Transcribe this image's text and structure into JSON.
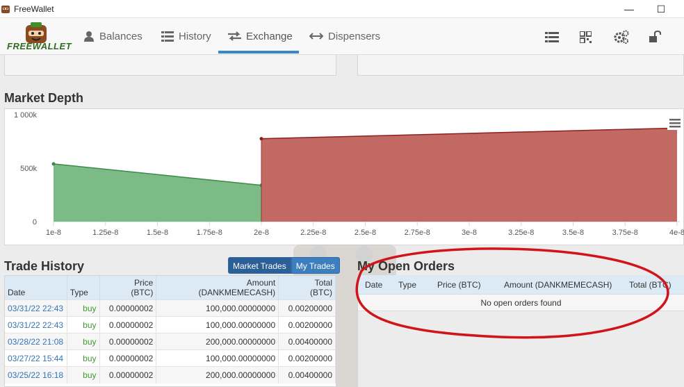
{
  "window": {
    "title": "FreeWallet",
    "minimize_glyph": "—",
    "maximize_glyph": "☐"
  },
  "brand": {
    "name": "FREEWALLET"
  },
  "nav": {
    "items": [
      {
        "label": "Balances",
        "icon": "user-icon"
      },
      {
        "label": "History",
        "icon": "list-icon"
      },
      {
        "label": "Exchange",
        "icon": "exchange-icon",
        "active": true
      },
      {
        "label": "Dispensers",
        "icon": "arrows-horizontal-icon"
      }
    ],
    "tools": [
      "menu-list-icon",
      "qr-code-icon",
      "gears-icon",
      "unlock-icon"
    ]
  },
  "market_depth": {
    "title": "Market Depth"
  },
  "chart_data": {
    "type": "area",
    "title": "",
    "xlabel": "",
    "ylabel": "",
    "x_ticks": [
      "1e-8",
      "1.25e-8",
      "1.5e-8",
      "1.75e-8",
      "2e-8",
      "2.25e-8",
      "2.5e-8",
      "2.75e-8",
      "3e-8",
      "3.25e-8",
      "3.5e-8",
      "3.75e-8",
      "4e-8"
    ],
    "y_ticks": [
      "0",
      "500k",
      "1 000k"
    ],
    "xlim": [
      1e-08,
      4e-08
    ],
    "ylim": [
      0,
      1000000
    ],
    "grid": false,
    "series": [
      {
        "role": "bids",
        "color": "#7cbb86",
        "line_color": "#3d8a45",
        "points": [
          [
            1e-08,
            540000
          ],
          [
            2e-08,
            340000
          ]
        ]
      },
      {
        "role": "asks",
        "color": "#c26964",
        "line_color": "#8e1f1f",
        "points": [
          [
            2e-08,
            775000
          ],
          [
            4e-08,
            875000
          ]
        ]
      }
    ]
  },
  "trade_history": {
    "title": "Trade History",
    "toggle": [
      "Market Trades",
      "My Trades"
    ],
    "columns": [
      {
        "line1": "",
        "line2": "Date"
      },
      {
        "line1": "",
        "line2": "Type"
      },
      {
        "line1": "Price",
        "line2": "(BTC)"
      },
      {
        "line1": "Amount",
        "line2": "(DANKMEMECASH)"
      },
      {
        "line1": "Total",
        "line2": "(BTC)"
      }
    ],
    "rows": [
      {
        "date": "03/31/22 22:43",
        "type": "buy",
        "price": "0.00000002",
        "amount": "100,000.00000000",
        "total": "0.00200000"
      },
      {
        "date": "03/31/22 22:43",
        "type": "buy",
        "price": "0.00000002",
        "amount": "100,000.00000000",
        "total": "0.00200000"
      },
      {
        "date": "03/28/22 21:08",
        "type": "buy",
        "price": "0.00000002",
        "amount": "200,000.00000000",
        "total": "0.00400000"
      },
      {
        "date": "03/27/22 15:44",
        "type": "buy",
        "price": "0.00000002",
        "amount": "100,000.00000000",
        "total": "0.00200000"
      },
      {
        "date": "03/25/22 16:18",
        "type": "buy",
        "price": "0.00000002",
        "amount": "200,000.00000000",
        "total": "0.00400000"
      }
    ]
  },
  "open_orders": {
    "title": "My Open Orders",
    "columns": [
      "Date",
      "Type",
      "Price (BTC)",
      "Amount (DANKMEMECASH)",
      "Total (BTC)"
    ],
    "empty_message": "No open orders found"
  },
  "colors": {
    "accent": "#3a87c8",
    "annotation": "#d0141a"
  }
}
